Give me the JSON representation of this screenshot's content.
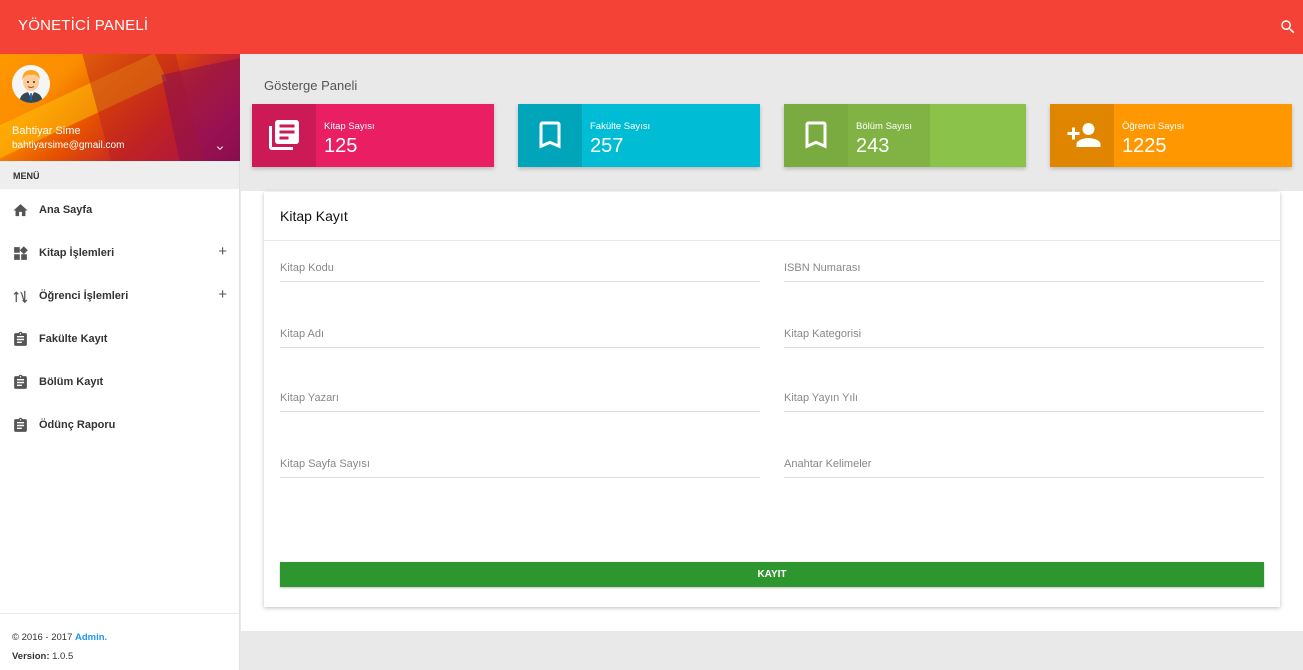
{
  "topbar": {
    "title": "YÖNETİCİ PANELİ",
    "search_icon": "search-icon"
  },
  "user": {
    "name": "Bahtiyar Sime",
    "email": "bahtiyarsime@gmail.com"
  },
  "menu": {
    "header": "MENÜ",
    "items": [
      {
        "label": "Ana Sayfa",
        "icon": "home-icon"
      },
      {
        "label": "Kitap İşlemleri",
        "icon": "widgets-icon",
        "expand": "+"
      },
      {
        "label": "Öğrenci İşlemleri",
        "icon": "swap-icon",
        "expand": "+"
      },
      {
        "label": "Fakülte Kayıt",
        "icon": "clipboard-icon"
      },
      {
        "label": "Bölüm Kayıt",
        "icon": "clipboard-icon"
      },
      {
        "label": "Ödünç Raporu",
        "icon": "clipboard-icon"
      }
    ]
  },
  "footer": {
    "copyright": "© 2016 - 2017 ",
    "admin": "Admin.",
    "version_label": "Version:",
    "version": " 1.0.5"
  },
  "page": {
    "title": "Gösterge Paneli"
  },
  "cards": [
    {
      "label": "Kitap Sayısı",
      "value": "125",
      "color": "#e91e63",
      "icon": "library-books-icon"
    },
    {
      "label": "Fakülte Sayısı",
      "value": "257",
      "color": "#00bcd4",
      "icon": "bookmark-icon"
    },
    {
      "label": "Bölüm Sayısı",
      "value": "243",
      "color": "#8bc34a",
      "icon": "bookmark-icon"
    },
    {
      "label": "Öğrenci Sayısı",
      "value": "1225",
      "color": "#ff9800",
      "icon": "person-add-icon"
    }
  ],
  "form": {
    "title": "Kitap Kayıt",
    "fields": [
      {
        "placeholder": "Kitap Kodu",
        "value": ""
      },
      {
        "placeholder": "ISBN Numarası",
        "value": ""
      },
      {
        "placeholder": "Kitap Adı",
        "value": ""
      },
      {
        "placeholder": "Kitap Kategorisi",
        "value": ""
      },
      {
        "placeholder": "Kitap Yazarı",
        "value": ""
      },
      {
        "placeholder": "Kitap Yayın Yılı",
        "value": ""
      },
      {
        "placeholder": "Kitap Sayfa Sayısı",
        "value": ""
      },
      {
        "placeholder": "Anahtar Kelimeler",
        "value": ""
      }
    ],
    "submit_label": "KAYIT",
    "submit_color": "#2e962e"
  }
}
